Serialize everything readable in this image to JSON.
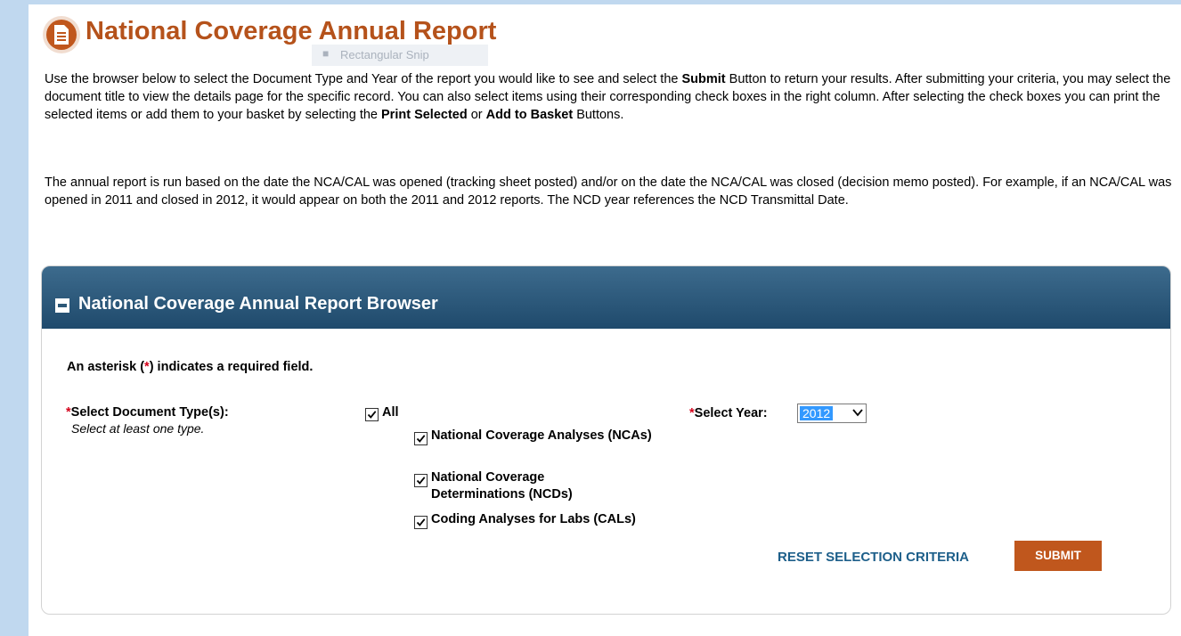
{
  "header": {
    "title": "National Coverage Annual Report",
    "icon": "document-icon",
    "accent_color": "#b5521b"
  },
  "overlay": {
    "snip_tooltip": "Rectangular Snip"
  },
  "intro": {
    "t1": "Use the browser below to select the Document Type and Year of the report you would like to see and select the ",
    "b1": "Submit",
    "t2": " Button to return your results. After submitting your criteria, you may select the document title to view the details page for the specific record. You can also select items using their corresponding check boxes in the right column. After selecting the check boxes you can print the selected items or add them to your basket by selecting the ",
    "b2": "Print Selected",
    "t3": " or ",
    "b3": "Add to Basket",
    "t4": " Buttons."
  },
  "annual_note": "The annual report is run based on the date the NCA/CAL was opened (tracking sheet posted) and/or on the date the NCA/CAL was closed (decision memo posted). For example, if an NCA/CAL was opened in 2011 and closed in 2012, it would appear on both the 2011 and 2012 reports. The NCD year references the NCD Transmittal Date.",
  "browser": {
    "title": "National Coverage Annual Report Browser",
    "header_color": "#2c5878",
    "required_note": {
      "pre": "An asterisk (",
      "star": "*",
      "post": ") indicates a required field."
    },
    "doc_type": {
      "star": "*",
      "label": "Select Document Type(s):",
      "hint": "Select at least one type.",
      "options": [
        {
          "label": "All",
          "checked": true
        },
        {
          "label": "National Coverage Analyses (NCAs)",
          "checked": true
        },
        {
          "label": "National Coverage Determinations (NCDs)",
          "checked": true
        },
        {
          "label": "Coding Analyses for Labs (CALs)",
          "checked": true
        }
      ]
    },
    "year": {
      "star": "*",
      "label": "Select Year:",
      "selected": "2012"
    },
    "reset_label": "RESET SELECTION CRITERIA",
    "submit_label": "SUBMIT",
    "submit_color": "#c0571d"
  }
}
